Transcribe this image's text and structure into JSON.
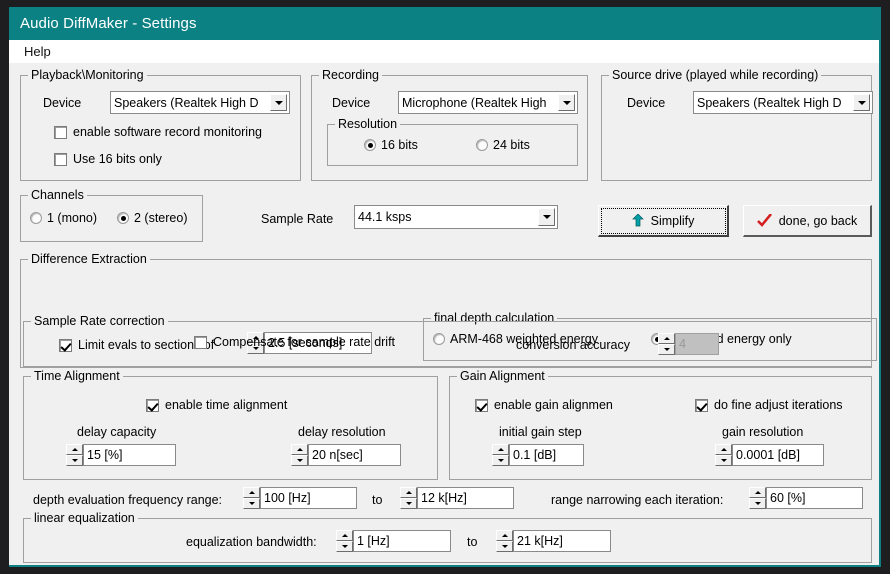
{
  "window": {
    "title": "Audio DiffMaker - Settings",
    "titlebar_color": "#0b8184"
  },
  "menubar": {
    "items": [
      {
        "label": "Help"
      }
    ]
  },
  "playback_monitoring": {
    "legend": "Playback\\Monitoring",
    "device_label": "Device",
    "device_value": "Speakers (Realtek High D",
    "enable_software_record_monitoring": {
      "label": "enable software record monitoring",
      "checked": false
    },
    "use_16_bits_only": {
      "label": "Use 16 bits only",
      "checked": false
    }
  },
  "recording": {
    "legend": "Recording",
    "device_label": "Device",
    "device_value": "Microphone (Realtek High",
    "resolution": {
      "legend": "Resolution",
      "options": [
        {
          "label": "16 bits",
          "selected": true
        },
        {
          "label": "24 bits",
          "selected": false
        }
      ]
    }
  },
  "source_drive": {
    "legend": "Source drive (played while recording)",
    "device_label": "Device",
    "device_value": "Speakers (Realtek High D"
  },
  "channels": {
    "legend": "Channels",
    "options": [
      {
        "label": "1 (mono)",
        "selected": false
      },
      {
        "label": "2 (stereo)",
        "selected": true
      }
    ]
  },
  "sample_rate": {
    "label": "Sample Rate",
    "value": "44.1 ksps"
  },
  "buttons": {
    "simplify": {
      "label": "Simplify",
      "icon": "up-arrow-icon",
      "icon_color": "#00a0a8",
      "focused": true
    },
    "done_go_back": {
      "label": "done, go back",
      "icon": "check-icon",
      "icon_color": "#d42020"
    }
  },
  "difference_extraction": {
    "legend": "Difference Extraction",
    "limit_evals": {
      "label": "Limit evals to sections of",
      "checked": true,
      "value": "2.5 [seconds]"
    }
  },
  "final_depth_calculation": {
    "legend": "final depth calculation",
    "options": [
      {
        "label": "ARM-468 weighted energy",
        "selected": false
      },
      {
        "label": "correlated energy only",
        "selected": true
      }
    ]
  },
  "sample_rate_correction": {
    "legend": "Sample Rate correction",
    "compensate": {
      "label": "Compensate for sample rate drift",
      "checked": false
    },
    "conversion_accuracy": {
      "label": "conversion accuracy",
      "value": "4",
      "disabled": true
    }
  },
  "time_alignment": {
    "legend": "Time Alignment",
    "enable": {
      "label": "enable time alignment",
      "checked": true
    },
    "delay_capacity": {
      "label": "delay capacity",
      "value": "15 [%]"
    },
    "delay_resolution": {
      "label": "delay resolution",
      "value": "20 n[sec]"
    }
  },
  "gain_alignment": {
    "legend": "Gain Alignment",
    "enable": {
      "label": "enable gain alignmen",
      "checked": true
    },
    "fine_adjust": {
      "label": "do fine adjust iterations",
      "checked": true
    },
    "initial_gain_step": {
      "label": "initial gain step",
      "value": "0.1 [dB]"
    },
    "gain_resolution": {
      "label": "gain resolution",
      "value": "0.0001 [dB]"
    }
  },
  "depth_evaluation": {
    "label": "depth evaluation frequency range:",
    "from_value": "100 [Hz]",
    "to_label": "to",
    "to_value": "12 k[Hz]",
    "narrowing_label": "range narrowing each iteration:",
    "narrowing_value": "60 [%]"
  },
  "linear_equalization": {
    "legend": "linear equalization",
    "label": "equalization bandwidth:",
    "from_value": "1 [Hz]",
    "to_label": "to",
    "to_value": "21 k[Hz]"
  }
}
